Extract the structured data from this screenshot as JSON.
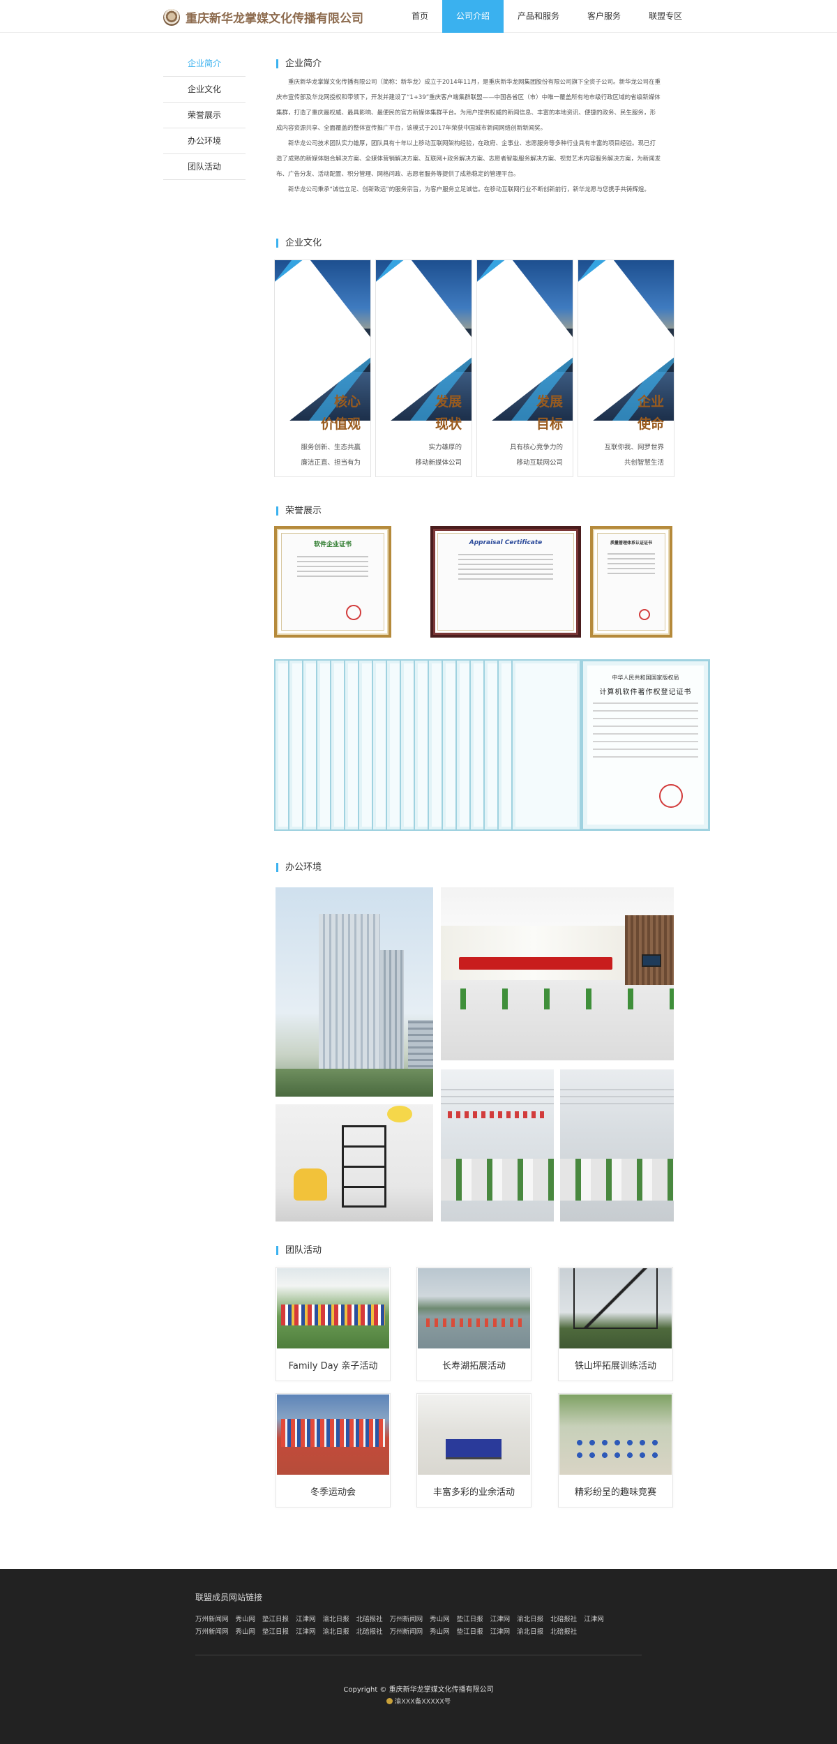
{
  "header": {
    "company_name": "重庆新华龙掌媒文化传播有限公司",
    "nav": [
      "首页",
      "公司介绍",
      "产品和服务",
      "客户服务",
      "联盟专区"
    ],
    "active_nav": "公司介绍"
  },
  "sidebar": {
    "items": [
      "企业简介",
      "企业文化",
      "荣誉展示",
      "办公环境",
      "团队活动"
    ],
    "active": "企业简介"
  },
  "sections": {
    "intro": "企业简介",
    "culture": "企业文化",
    "honors": "荣誉展示",
    "office": "办公环境",
    "team": "团队活动"
  },
  "intro": {
    "paragraphs": [
      "重庆新华龙掌媒文化传播有限公司（简称：新华龙）成立于2014年11月，是重庆新华龙网集团股份有限公司旗下全资子公司。新华龙公司在重庆市宣传部及华龙网授权和带领下，开发并建设了“1+39”重庆客户端集群联盟——中国各省区（市）中唯一覆盖所有地市级行政区域的省级新媒体集群，打造了重庆最权威、最具影响、最便民的官方新媒体集群平台。为用户提供权威的新闻信息、丰富的本地资讯、便捷的政务、民生服务，形成内容资源共享、全面覆盖的整体宣传推广平台，该模式于2017年荣获中国城市新闻网络创新新闻奖。",
      "新华龙公司技术团队实力雄厚，团队具有十年以上移动互联网架构经验，在政府、企事业、志愿服务等多种行业具有丰富的项目经验。现已打造了成熟的新媒体融合解决方案、全媒体营销解决方案、互联网+政务解决方案、志愿者智能服务解决方案、视觉艺术内容服务解决方案，为新闻发布、广告分发、活动配置、积分管理、网格问政、志愿者服务等提供了成熟稳定的管理平台。",
      "新华龙公司秉承“诚信立足、创新致远”的服务宗旨，为客户服务立足诚信。在移动互联网行业不断创新前行，新华龙愿与您携手共铸辉煌。"
    ]
  },
  "culture_cards": [
    {
      "title1": "核心",
      "title2": "价值观",
      "desc1": "服务创新、生态共赢",
      "desc2": "廉洁正直、担当有为"
    },
    {
      "title1": "发展",
      "title2": "现状",
      "desc1": "实力雄厚的",
      "desc2": "移动新媒体公司"
    },
    {
      "title1": "发展",
      "title2": "目标",
      "desc1": "具有核心竞争力的",
      "desc2": "移动互联网公司"
    },
    {
      "title1": "企业",
      "title2": "使命",
      "desc1": "互联你我、网罗世界",
      "desc2": "共创智慧生活"
    }
  ],
  "certificates": {
    "software_enterprise": "软件企业证书",
    "appraisal": "Appraisal Certificate",
    "quality": "质量管理体系认证证书",
    "copyright_line1": "中华人民共和国国家版权局",
    "copyright_line2": "计算机软件著作权登记证书"
  },
  "team_activities": [
    "Family Day 亲子活动",
    "长寿湖拓展活动",
    "铁山坪拓展训练活动",
    "冬季运动会",
    "丰富多彩的业余活动",
    "精彩纷呈的趣味竞赛"
  ],
  "footer": {
    "links_heading": "联盟成员网站链接",
    "links_row1": [
      "万州新闻网",
      "秀山网",
      "垫江日报",
      "江津网",
      "渝北日报",
      "北碚报社",
      "万州新闻网",
      "秀山网",
      "垫江日报",
      "江津网",
      "渝北日报",
      "北碚报社",
      "江津网"
    ],
    "links_row2": [
      "万州新闻网",
      "秀山网",
      "垫江日报",
      "江津网",
      "渝北日报",
      "北碚报社",
      "万州新闻网",
      "秀山网",
      "垫江日报",
      "江津网",
      "渝北日报",
      "北碚报社"
    ],
    "copyright": "Copyright © 重庆新华龙掌媒文化传播有限公司",
    "icp": "渝XXX备XXXXX号"
  },
  "colors": {
    "accent": "#3ab1ef",
    "culture_title": "#9a5b1e",
    "footer_bg": "#222222"
  }
}
